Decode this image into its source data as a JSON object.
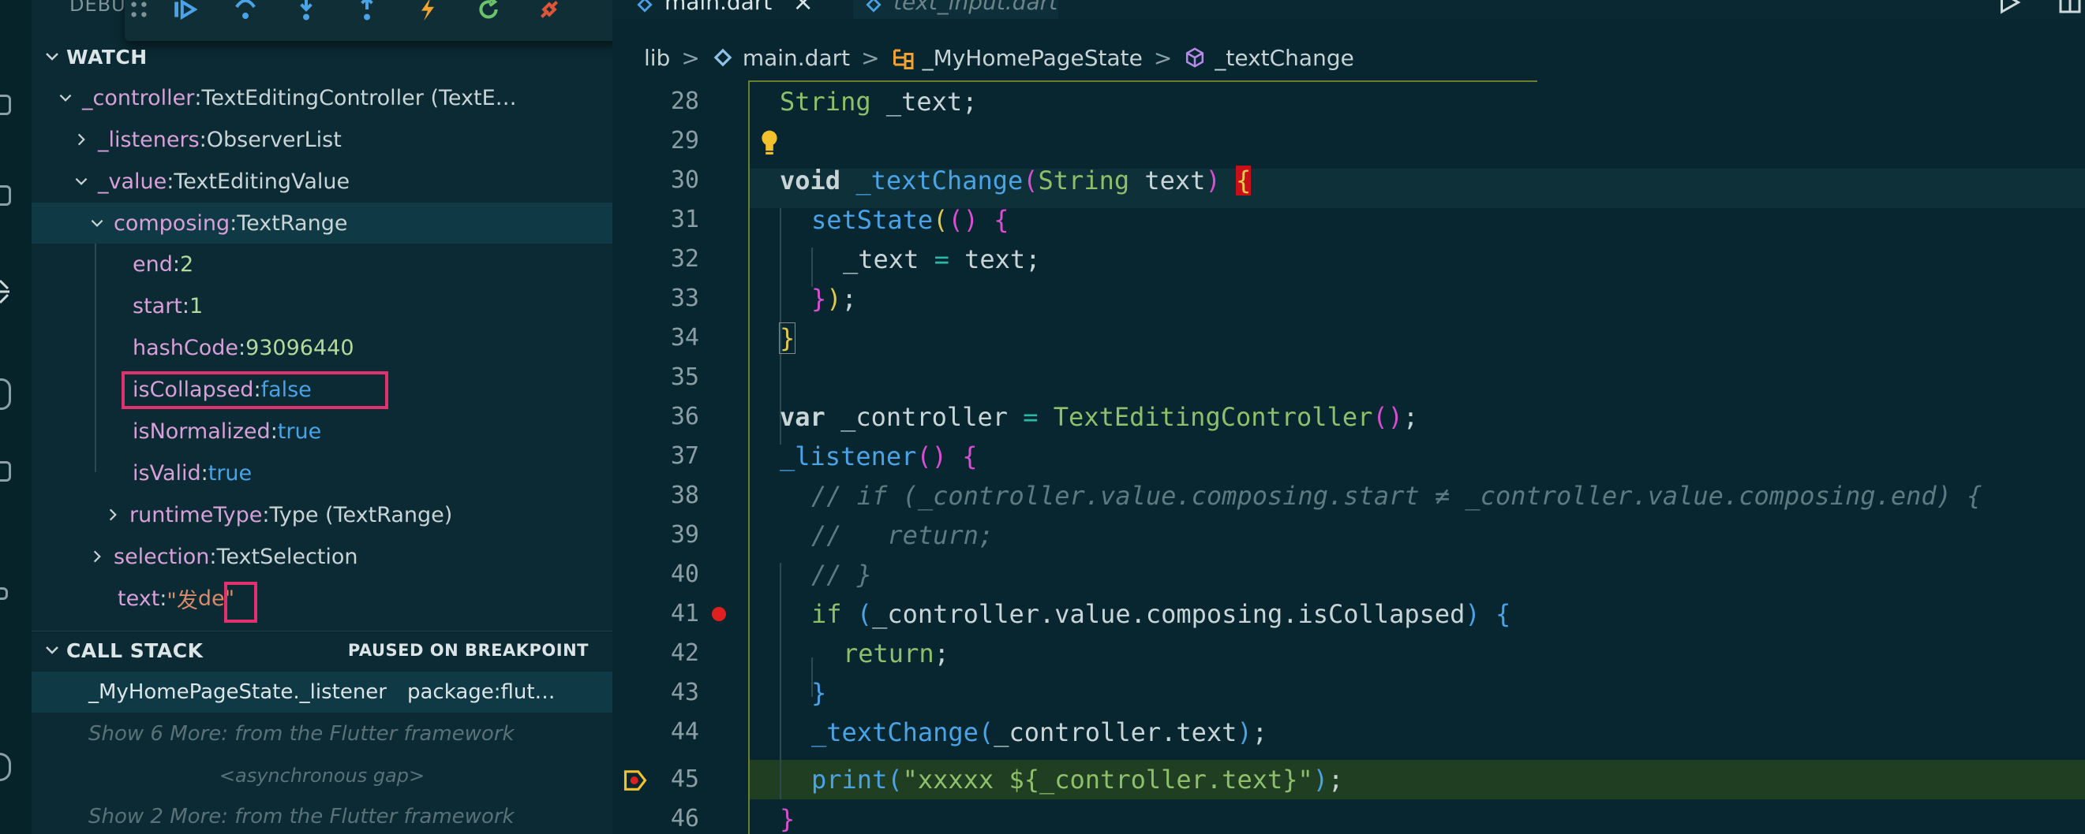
{
  "sidebar": {
    "debug_title": "DEBU",
    "watch": {
      "title": "WATCH",
      "items": [
        {
          "key": "_controller",
          "sep": ": ",
          "value": "TextEditingController (TextE…"
        },
        {
          "key": "_listeners",
          "sep": ": ",
          "value": "ObserverList"
        },
        {
          "key": "_value",
          "sep": ": ",
          "value": "TextEditingValue"
        },
        {
          "key": "composing",
          "sep": ": ",
          "value": "TextRange"
        },
        {
          "key": "end",
          "sep": ": ",
          "value": "2"
        },
        {
          "key": "start",
          "sep": ": ",
          "value": "1"
        },
        {
          "key": "hashCode",
          "sep": ": ",
          "value": "93096440"
        },
        {
          "key": "isCollapsed",
          "sep": ": ",
          "value": "false"
        },
        {
          "key": "isNormalized",
          "sep": ": ",
          "value": "true"
        },
        {
          "key": "isValid",
          "sep": ": ",
          "value": "true"
        },
        {
          "key": "runtimeType",
          "sep": ": ",
          "value": "Type (TextRange)"
        },
        {
          "key": "selection",
          "sep": ": ",
          "value": "TextSelection"
        },
        {
          "key": "text",
          "sep": ": ",
          "value_a": "\"发",
          "value_b": "de",
          "value_c": "\""
        }
      ]
    },
    "callstack": {
      "title": "CALL STACK",
      "status": "PAUSED ON BREAKPOINT",
      "frame_name": "_MyHomePageState._listener",
      "frame_source": "package:flut…",
      "more_1": "Show 6 More: from the Flutter framework",
      "gap": "<asynchronous gap>",
      "more_2": "Show 2 More: from the Flutter framework"
    }
  },
  "editor": {
    "tabs": [
      {
        "label": "main.dart",
        "close": "×"
      },
      {
        "label": "text_input.dart"
      }
    ],
    "breadcrumb": [
      "lib",
      "main.dart",
      "_MyHomePageState",
      "_textChange"
    ],
    "separator": ">",
    "line_numbers": [
      "28",
      "29",
      "30",
      "31",
      "32",
      "33",
      "34",
      "35",
      "36",
      "37",
      "38",
      "39",
      "40",
      "41",
      "42",
      "43",
      "44",
      "45",
      "46"
    ],
    "code": {
      "l28": {
        "a": "String",
        "b": " _text;"
      },
      "l30": {
        "a": "void",
        "b": " ",
        "c": "_textChange",
        "d": "(",
        "e": "String",
        "f": " text",
        "g": ")",
        "h": " ",
        "i": "{"
      },
      "l31": {
        "a": "setState",
        "b": "(",
        "c": "()",
        "d": " {"
      },
      "l32": {
        "a": "_text",
        "b": " = ",
        "c": "text;"
      },
      "l33": {
        "a": "}",
        "b": ")",
        "c": ";"
      },
      "l34": {
        "a": "}"
      },
      "l36": {
        "a": "var",
        "b": " _controller ",
        "c": "=",
        "d": " ",
        "e": "TextEditingController",
        "f": "()",
        "g": ";"
      },
      "l37": {
        "a": "_listener",
        "b": "()",
        "c": " {"
      },
      "l38": {
        "a": "// if (_controller.value.composing.start ≠ _controller.value.composing.end) {"
      },
      "l39": {
        "a": "//   return;"
      },
      "l40": {
        "a": "// }"
      },
      "l41": {
        "a": "if",
        "b": " (",
        "c": "_controller.value.composing.isCollapsed",
        "d": ")",
        "e": " {"
      },
      "l42": {
        "a": "return",
        "b": ";"
      },
      "l43": {
        "a": "}"
      },
      "l44": {
        "a": "_textChange",
        "b": "(",
        "c": "_controller.text",
        "d": ")",
        "e": ";"
      },
      "l45": {
        "a": "print",
        "b": "(",
        "c": "\"xxxxx ${_controller.text}\"",
        "d": ")",
        "e": ";"
      },
      "l46": {
        "a": "}"
      }
    }
  },
  "colors": {
    "background": "#0b2a33",
    "editor_bg": "#072630",
    "highlight_line": "#1f3e22",
    "breakpoint": "#e02020",
    "annotation_box": "#e0326e",
    "bracket_error": "#c8101a",
    "lightbulb": "#f2c12e"
  }
}
